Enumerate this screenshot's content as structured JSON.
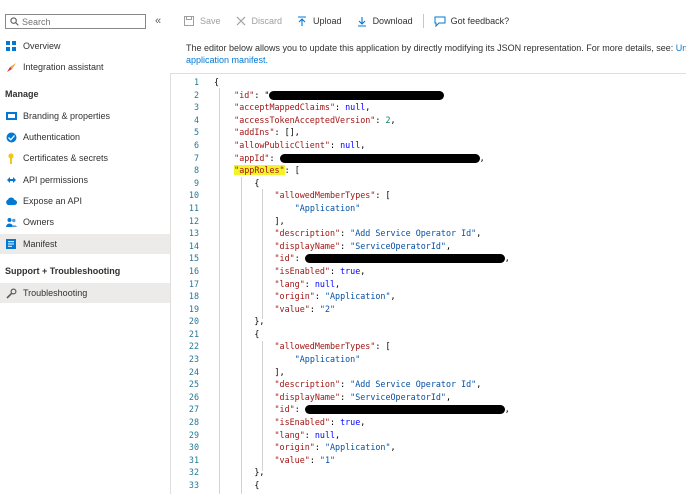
{
  "sidebar": {
    "search_placeholder": "Search",
    "collapse_glyph": "«",
    "top_items": [
      {
        "label": "Overview",
        "icon": "grid-icon"
      },
      {
        "label": "Integration assistant",
        "icon": "rocket-icon"
      }
    ],
    "manage_heading": "Manage",
    "manage_items": [
      {
        "label": "Branding & properties",
        "icon": "branding-icon"
      },
      {
        "label": "Authentication",
        "icon": "authentication-icon"
      },
      {
        "label": "Certificates & secrets",
        "icon": "key-icon"
      },
      {
        "label": "API permissions",
        "icon": "api-permissions-icon"
      },
      {
        "label": "Expose an API",
        "icon": "cloud-icon"
      },
      {
        "label": "Owners",
        "icon": "owners-icon"
      },
      {
        "label": "Manifest",
        "icon": "manifest-icon"
      }
    ],
    "support_heading": "Support + Troubleshooting",
    "support_items": [
      {
        "label": "Troubleshooting",
        "icon": "wrench-icon"
      }
    ]
  },
  "toolbar": {
    "save": "Save",
    "discard": "Discard",
    "upload": "Upload",
    "download": "Download",
    "feedback": "Got feedback?"
  },
  "description": {
    "text": "The editor below allows you to update this application by directly modifying its JSON representation. For more details, see: ",
    "link1": "Unders",
    "link2": "application manifest."
  },
  "editor": {
    "line_numbers": [
      "1",
      "2",
      "3",
      "4",
      "5",
      "6",
      "7",
      "8",
      "9",
      "10",
      "11",
      "12",
      "13",
      "14",
      "15",
      "16",
      "17",
      "18",
      "19",
      "20",
      "21",
      "22",
      "23",
      "24",
      "25",
      "26",
      "27",
      "28",
      "29",
      "30",
      "31",
      "32",
      "33"
    ],
    "tokens": {
      "open_brace": "{",
      "id_key": "\"id\"",
      "id_val_prefix": ": \"",
      "accept_key": "\"acceptMappedClaims\"",
      "null_val": "null",
      "token_ver_key": "\"accessTokenAcceptedVersion\"",
      "token_ver_val": "2",
      "addins_key": "\"addIns\"",
      "empty_array": "[]",
      "allow_public_key": "\"allowPublicClient\"",
      "appid_key": "\"appId\"",
      "approles_key": "\"appRoles\"",
      "open_bracket": "[",
      "close_bracket": "]",
      "close_brace": "}",
      "allowed_types_key": "\"allowedMemberTypes\"",
      "application_str": "\"Application\"",
      "description_key": "\"description\"",
      "description_val": "\"Add Service Operator Id\"",
      "display_key": "\"displayName\"",
      "display_val": "\"ServiceOperatorId\"",
      "enabled_key": "\"isEnabled\"",
      "true_val": "true",
      "lang_key": "\"lang\"",
      "origin_key": "\"origin\"",
      "value_key": "\"value\"",
      "value_2": "\"2\"",
      "value_1": "\"1\""
    }
  }
}
